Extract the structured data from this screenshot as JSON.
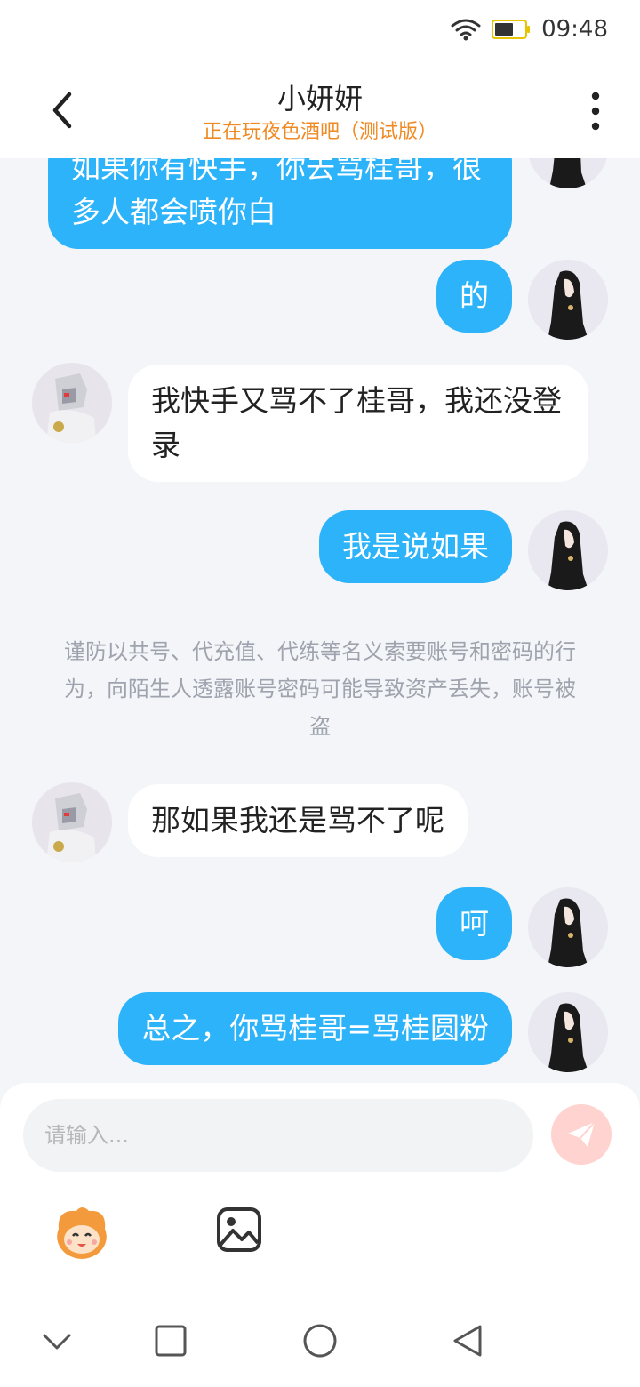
{
  "status": {
    "time": "09:48",
    "wifi_icon": "wifi-icon",
    "battery_icon": "battery-icon"
  },
  "header": {
    "title": "小妍妍",
    "subtitle": "正在玩夜色酒吧（测试版）"
  },
  "messages": [
    {
      "side": "right",
      "text": "如果你有快手，你去骂桂哥，很多人都会喷你白"
    },
    {
      "side": "right",
      "text": "的"
    },
    {
      "side": "left",
      "text": "我快手又骂不了桂哥，我还没登录"
    },
    {
      "side": "right",
      "text": "我是说如果"
    },
    {
      "side": "left",
      "text": "那如果我还是骂不了呢"
    },
    {
      "side": "right",
      "text": "呵"
    },
    {
      "side": "right",
      "text": "总之，你骂桂哥=骂桂圆粉"
    }
  ],
  "notice": "谨防以共号、代充值、代练等名义索要账号和密码的行为，向陌生人透露账号密码可能导致资产丢失，账号被盗",
  "input": {
    "placeholder": "请输入..."
  },
  "colors": {
    "accent": "#2db3f9",
    "subtitle": "#f08a24",
    "send_button": "#ffd3cf"
  }
}
